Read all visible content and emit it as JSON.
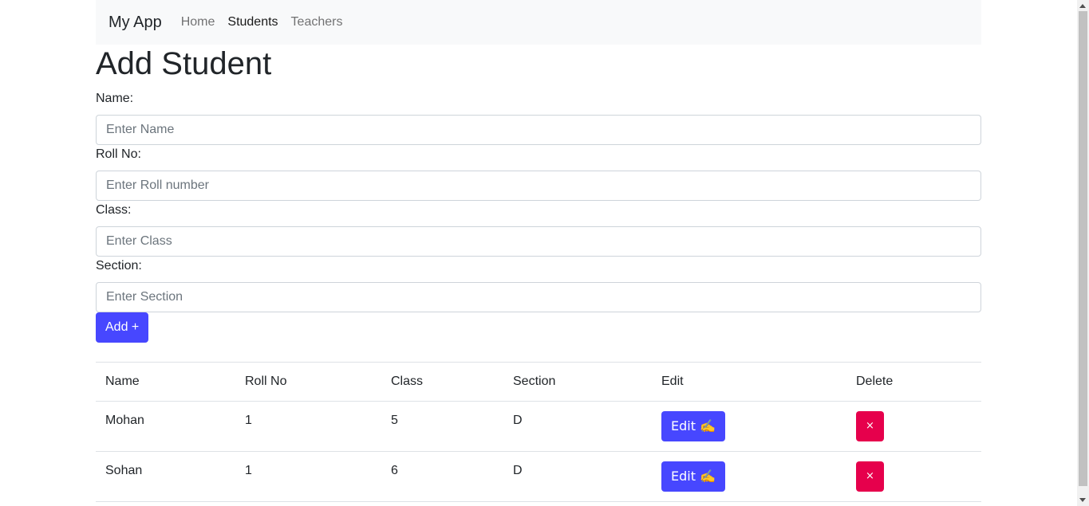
{
  "navbar": {
    "brand": "My App",
    "links": [
      {
        "label": "Home",
        "active": false
      },
      {
        "label": "Students",
        "active": true
      },
      {
        "label": "Teachers",
        "active": false
      }
    ]
  },
  "page_title": "Add Student",
  "form": {
    "fields": [
      {
        "label": "Name:",
        "placeholder": "Enter Name",
        "value": ""
      },
      {
        "label": "Roll No:",
        "placeholder": "Enter Roll number",
        "value": ""
      },
      {
        "label": "Class:",
        "placeholder": "Enter Class",
        "value": ""
      },
      {
        "label": "Section:",
        "placeholder": "Enter Section",
        "value": ""
      }
    ],
    "add_label": "Add +"
  },
  "table": {
    "headers": [
      "Name",
      "Roll No",
      "Class",
      "Section",
      "Edit",
      "Delete"
    ],
    "rows": [
      {
        "name": "Mohan",
        "roll": "1",
        "class": "5",
        "section": "D",
        "edit_label": "Edit ✍️",
        "delete_label": "×"
      },
      {
        "name": "Sohan",
        "roll": "1",
        "class": "6",
        "section": "D",
        "edit_label": "Edit ✍️",
        "delete_label": "×"
      }
    ]
  },
  "colors": {
    "primary": "#4747ff",
    "danger": "#e6004c",
    "navbar_bg": "#f8f9fa"
  }
}
